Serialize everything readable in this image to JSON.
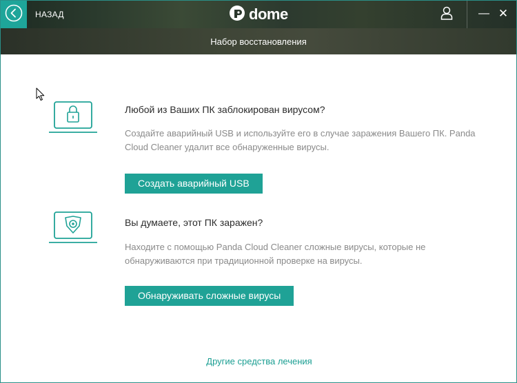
{
  "header": {
    "back_label": "НАЗАД",
    "logo_text": "dome",
    "logo_icon": "panda-logo-icon",
    "user_icon": "user-icon",
    "minimize_label": "—",
    "close_label": "✕"
  },
  "page": {
    "title": "Набор восстановления"
  },
  "sections": [
    {
      "icon": "laptop-lock-icon",
      "title": "Любой из Ваших ПК заблокирован вирусом?",
      "description": "Создайте аварийный USB и используйте его в случае заражения Вашего ПК. Panda Cloud Cleaner удалит все обнаруженные вирусы.",
      "button_label": "Создать аварийный USB"
    },
    {
      "icon": "laptop-virus-icon",
      "title": "Вы думаете, этот ПК заражен?",
      "description": "Находите с помощью Panda Cloud Cleaner сложные вирусы, которые не обнаруживаются при традиционной проверке на вирусы.",
      "button_label": "Обнаруживать сложные вирусы"
    }
  ],
  "footer": {
    "link_label": "Другие средства лечения"
  },
  "colors": {
    "accent": "#1fa296",
    "link": "#1a9e92",
    "title_text": "#2b2b2b",
    "desc_text": "#8a8a8a"
  }
}
